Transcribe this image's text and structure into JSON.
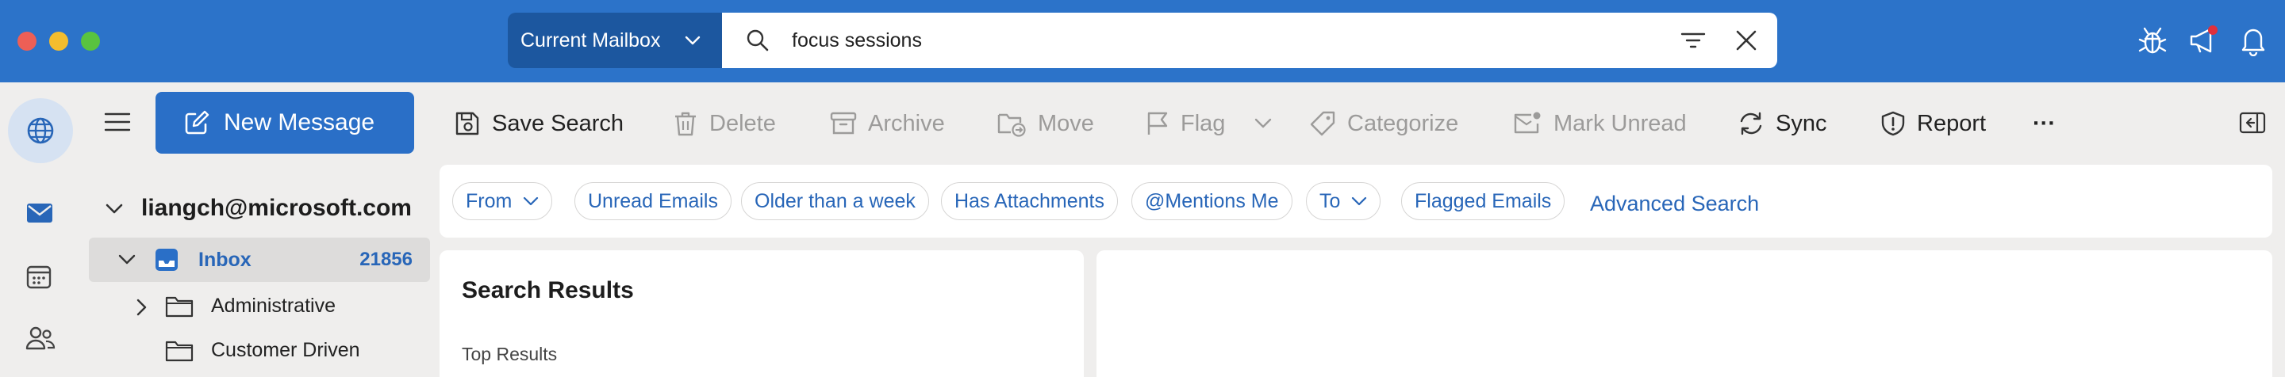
{
  "titlebar": {
    "scope_label": "Current Mailbox",
    "search_value": "focus sessions",
    "right_icons": [
      "bug-icon",
      "megaphone-icon",
      "bell-icon"
    ],
    "colors": {
      "bar": "#2c73c9",
      "scope": "#1c579f"
    }
  },
  "rail": {
    "items": [
      "globe-icon",
      "mail-icon",
      "calendar-icon",
      "people-icon"
    ]
  },
  "toolbar": {
    "new_message": "New Message",
    "save_search": "Save Search",
    "delete": "Delete",
    "archive": "Archive",
    "move": "Move",
    "flag": "Flag",
    "categorize": "Categorize",
    "mark_unread": "Mark Unread",
    "sync": "Sync",
    "report": "Report",
    "more": "···"
  },
  "folders": {
    "account": "liangch@microsoft.com",
    "inbox": {
      "label": "Inbox",
      "count": "21856"
    },
    "items": [
      {
        "label": "Administrative"
      },
      {
        "label": "Customer Driven"
      }
    ]
  },
  "filters": {
    "from": "From",
    "unread": "Unread Emails",
    "older": "Older than a week",
    "attachments": "Has Attachments",
    "mentions": "@Mentions Me",
    "to": "To",
    "flagged": "Flagged Emails",
    "advanced": "Advanced Search"
  },
  "results": {
    "title": "Search Results",
    "section": "Top Results"
  },
  "colors": {
    "accent": "#2a6fc7",
    "link": "#2866b8",
    "background": "#efeeed"
  }
}
